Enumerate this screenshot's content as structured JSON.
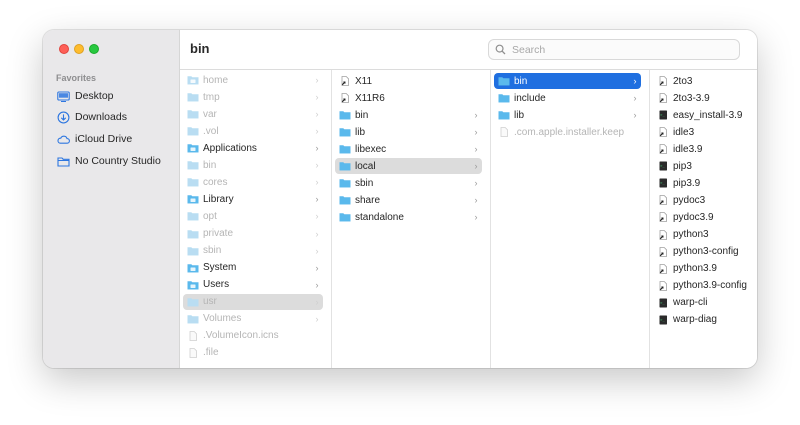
{
  "window": {
    "title": "bin"
  },
  "search": {
    "placeholder": "Search"
  },
  "sidebar": {
    "section_title": "Favorites",
    "items": [
      {
        "label": "Desktop",
        "icon": "desktop-icon"
      },
      {
        "label": "Downloads",
        "icon": "downloads-icon"
      },
      {
        "label": "iCloud Drive",
        "icon": "cloud-icon"
      },
      {
        "label": "No Country Studio",
        "icon": "folder-icon"
      }
    ]
  },
  "columns": [
    {
      "items": [
        {
          "label": "home",
          "kind": "folder-alias",
          "dim": true,
          "chevron": true
        },
        {
          "label": "tmp",
          "kind": "folder",
          "dim": true,
          "chevron": true
        },
        {
          "label": "var",
          "kind": "folder",
          "dim": true,
          "chevron": true
        },
        {
          "label": ".vol",
          "kind": "folder",
          "dim": true,
          "chevron": true
        },
        {
          "label": "Applications",
          "kind": "folder-app",
          "dim": false,
          "chevron": true
        },
        {
          "label": "bin",
          "kind": "folder",
          "dim": true,
          "chevron": true
        },
        {
          "label": "cores",
          "kind": "folder",
          "dim": true,
          "chevron": true
        },
        {
          "label": "Library",
          "kind": "folder-lib",
          "dim": false,
          "chevron": true
        },
        {
          "label": "opt",
          "kind": "folder",
          "dim": true,
          "chevron": true
        },
        {
          "label": "private",
          "kind": "folder",
          "dim": true,
          "chevron": true
        },
        {
          "label": "sbin",
          "kind": "folder",
          "dim": true,
          "chevron": true
        },
        {
          "label": "System",
          "kind": "folder-sys",
          "dim": false,
          "chevron": true
        },
        {
          "label": "Users",
          "kind": "folder-users",
          "dim": false,
          "chevron": true
        },
        {
          "label": "usr",
          "kind": "folder",
          "dim": true,
          "chevron": true,
          "selected": "gray"
        },
        {
          "label": "Volumes",
          "kind": "folder",
          "dim": true,
          "chevron": true
        },
        {
          "label": ".VolumeIcon.icns",
          "kind": "file",
          "dim": true,
          "chevron": false
        },
        {
          "label": ".file",
          "kind": "file",
          "dim": true,
          "chevron": false
        }
      ]
    },
    {
      "items": [
        {
          "label": "X11",
          "kind": "alias",
          "dim": false,
          "chevron": false
        },
        {
          "label": "X11R6",
          "kind": "alias",
          "dim": false,
          "chevron": false
        },
        {
          "label": "bin",
          "kind": "folder",
          "dim": false,
          "chevron": true
        },
        {
          "label": "lib",
          "kind": "folder",
          "dim": false,
          "chevron": true
        },
        {
          "label": "libexec",
          "kind": "folder",
          "dim": false,
          "chevron": true
        },
        {
          "label": "local",
          "kind": "folder",
          "dim": false,
          "chevron": true,
          "selected": "gray"
        },
        {
          "label": "sbin",
          "kind": "folder",
          "dim": false,
          "chevron": true
        },
        {
          "label": "share",
          "kind": "folder",
          "dim": false,
          "chevron": true
        },
        {
          "label": "standalone",
          "kind": "folder",
          "dim": false,
          "chevron": true
        }
      ]
    },
    {
      "items": [
        {
          "label": "bin",
          "kind": "folder",
          "dim": false,
          "chevron": true,
          "selected": "blue"
        },
        {
          "label": "include",
          "kind": "folder",
          "dim": false,
          "chevron": true
        },
        {
          "label": "lib",
          "kind": "folder",
          "dim": false,
          "chevron": true
        },
        {
          "label": ".com.apple.installer.keep",
          "kind": "file",
          "dim": true,
          "chevron": false
        }
      ]
    },
    {
      "items": [
        {
          "label": "2to3",
          "kind": "alias",
          "dim": false,
          "chevron": false
        },
        {
          "label": "2to3-3.9",
          "kind": "alias",
          "dim": false,
          "chevron": false
        },
        {
          "label": "easy_install-3.9",
          "kind": "exec",
          "dim": false,
          "chevron": false
        },
        {
          "label": "idle3",
          "kind": "alias",
          "dim": false,
          "chevron": false
        },
        {
          "label": "idle3.9",
          "kind": "alias",
          "dim": false,
          "chevron": false
        },
        {
          "label": "pip3",
          "kind": "exec",
          "dim": false,
          "chevron": false
        },
        {
          "label": "pip3.9",
          "kind": "exec",
          "dim": false,
          "chevron": false
        },
        {
          "label": "pydoc3",
          "kind": "alias",
          "dim": false,
          "chevron": false
        },
        {
          "label": "pydoc3.9",
          "kind": "alias",
          "dim": false,
          "chevron": false
        },
        {
          "label": "python3",
          "kind": "alias",
          "dim": false,
          "chevron": false
        },
        {
          "label": "python3-config",
          "kind": "alias",
          "dim": false,
          "chevron": false
        },
        {
          "label": "python3.9",
          "kind": "alias",
          "dim": false,
          "chevron": false
        },
        {
          "label": "python3.9-config",
          "kind": "alias",
          "dim": false,
          "chevron": false
        },
        {
          "label": "warp-cli",
          "kind": "exec",
          "dim": false,
          "chevron": false
        },
        {
          "label": "warp-diag",
          "kind": "exec",
          "dim": false,
          "chevron": false
        }
      ]
    }
  ],
  "colors": {
    "folder": "#5bb8ec",
    "folder_dim": "#b8ddf2",
    "selection_blue": "#1f6fe0",
    "selection_gray": "#dcdcdc",
    "sidebar_icon": "#2d76e0"
  }
}
